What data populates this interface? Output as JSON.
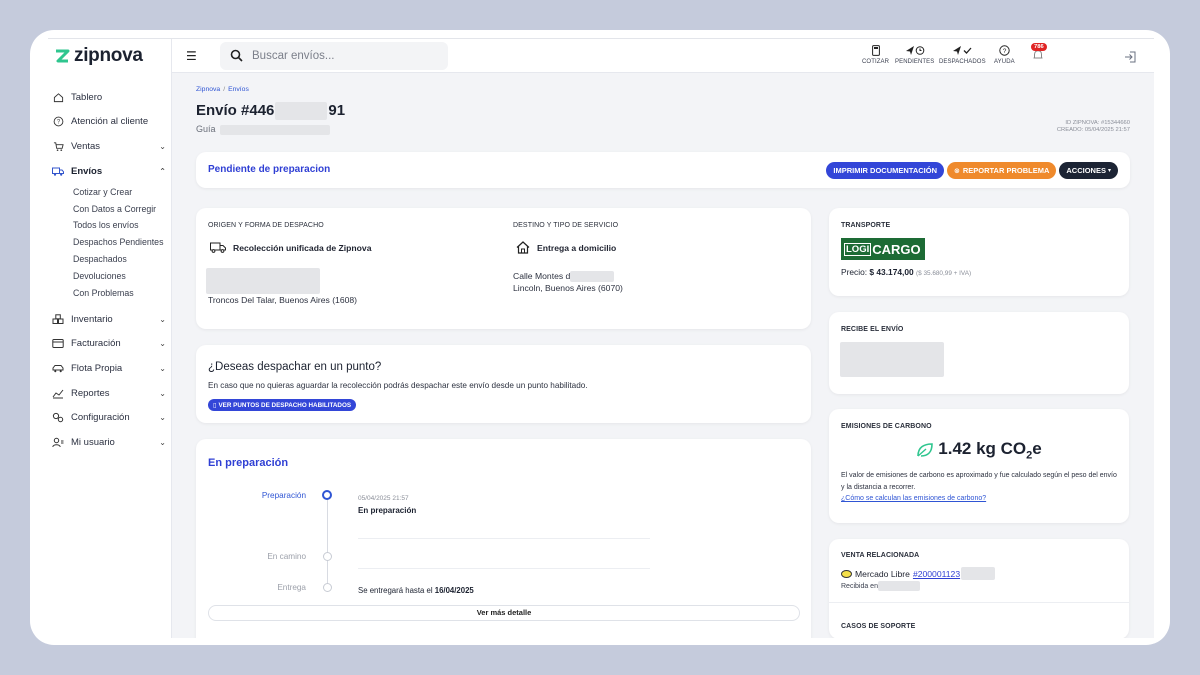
{
  "brand": {
    "name": "zipnova",
    "accent": "#2fc68f",
    "primary": "#2f3fd4"
  },
  "sidebar": {
    "items": [
      {
        "label": "Tablero",
        "icon": "home-icon"
      },
      {
        "label": "Atención al cliente",
        "icon": "help-circle-icon"
      },
      {
        "label": "Ventas",
        "icon": "cart-icon"
      },
      {
        "label": "Envíos",
        "icon": "truck-icon"
      },
      {
        "label": "Inventario",
        "icon": "boxes-icon"
      },
      {
        "label": "Facturación",
        "icon": "invoice-icon"
      },
      {
        "label": "Flota Propia",
        "icon": "car-icon"
      },
      {
        "label": "Reportes",
        "icon": "chart-icon"
      },
      {
        "label": "Configuración",
        "icon": "gears-icon"
      },
      {
        "label": "Mi usuario",
        "icon": "user-icon"
      }
    ],
    "envios_sub": [
      "Cotizar y Crear",
      "Con Datos a Corregir",
      "Todos los envíos",
      "Despachos Pendientes",
      "Despachados",
      "Devoluciones",
      "Con Problemas"
    ]
  },
  "topbar": {
    "search_placeholder": "Buscar envíos...",
    "tools": [
      {
        "label": "COTIZAR",
        "icon": "calculator-icon"
      },
      {
        "label": "PENDIENTES",
        "icon": "send-clock-icon"
      },
      {
        "label": "DESPACHADOS",
        "icon": "send-check-icon"
      },
      {
        "label": "AYUDA",
        "icon": "question-icon"
      }
    ],
    "notifications_count": "786"
  },
  "page": {
    "breadcrumb": [
      "Zipnova",
      "Envíos"
    ],
    "title_prefix": "Envío #446",
    "title_suffix": "91",
    "guia_label": "Guía",
    "id_line": "ID ZIPNOVA: #15344660",
    "created_line": "CREADO: 05/04/2025 21:57"
  },
  "status_bar": {
    "status": "Pendiente de preparacion",
    "print_label": "IMPRIMIR DOCUMENTACIÓN",
    "report_label": "REPORTAR PROBLEMA",
    "actions_label": "ACCIONES"
  },
  "origin": {
    "heading": "ORIGEN Y FORMA DE DESPACHO",
    "method": "Recolección unificada de Zipnova",
    "address": "Troncos Del Talar, Buenos Aires (1608)"
  },
  "destination": {
    "heading": "DESTINO Y TIPO DE SERVICIO",
    "service": "Entrega a domicilio",
    "street": "Calle Montes d",
    "city": "Lincoln, Buenos Aires (6070)"
  },
  "dispatch_point": {
    "title": "¿Deseas despachar en un punto?",
    "text": "En caso que no quieras aguardar la recolección podrás despachar este envío desde un punto habilitado.",
    "button": "VER PUNTOS DE DESPACHO HABILITADOS"
  },
  "tracking": {
    "title": "En preparación",
    "steps": [
      {
        "label": "Preparación",
        "date": "05/04/2025 21:57",
        "detail": "En preparación",
        "active": true
      },
      {
        "label": "En camino",
        "date": "",
        "detail": "",
        "active": false
      },
      {
        "label": "Entrega",
        "date": "",
        "detail_prefix": "Se entregará hasta el ",
        "detail_strong": "16/04/2025",
        "active": false
      }
    ],
    "more_button": "Ver más detalle"
  },
  "transport": {
    "heading": "TRANSPORTE",
    "carrier_logo_left": "LOGI",
    "carrier_logo_right": "CARGO",
    "price_label": "Precio:",
    "price": "$ 43.174,00",
    "price_note": "($ 35.680,99 + IVA)"
  },
  "receiver": {
    "heading": "RECIBE EL ENVÍO"
  },
  "carbon": {
    "heading": "EMISIONES DE CARBONO",
    "value": "1.42 kg CO",
    "subscript": "2",
    "suffix": "e",
    "text": "El valor de emisiones de carbono es aproximado y fue calculado según el peso del envío y la distancia a recorrer.",
    "link": "¿Cómo se calculan las emisiones de carbono?"
  },
  "related_sale": {
    "heading": "VENTA RELACIONADA",
    "channel": "Mercado Libre",
    "order": "#200001123",
    "received": "Recibida en"
  },
  "support": {
    "heading": "CASOS DE SOPORTE"
  }
}
